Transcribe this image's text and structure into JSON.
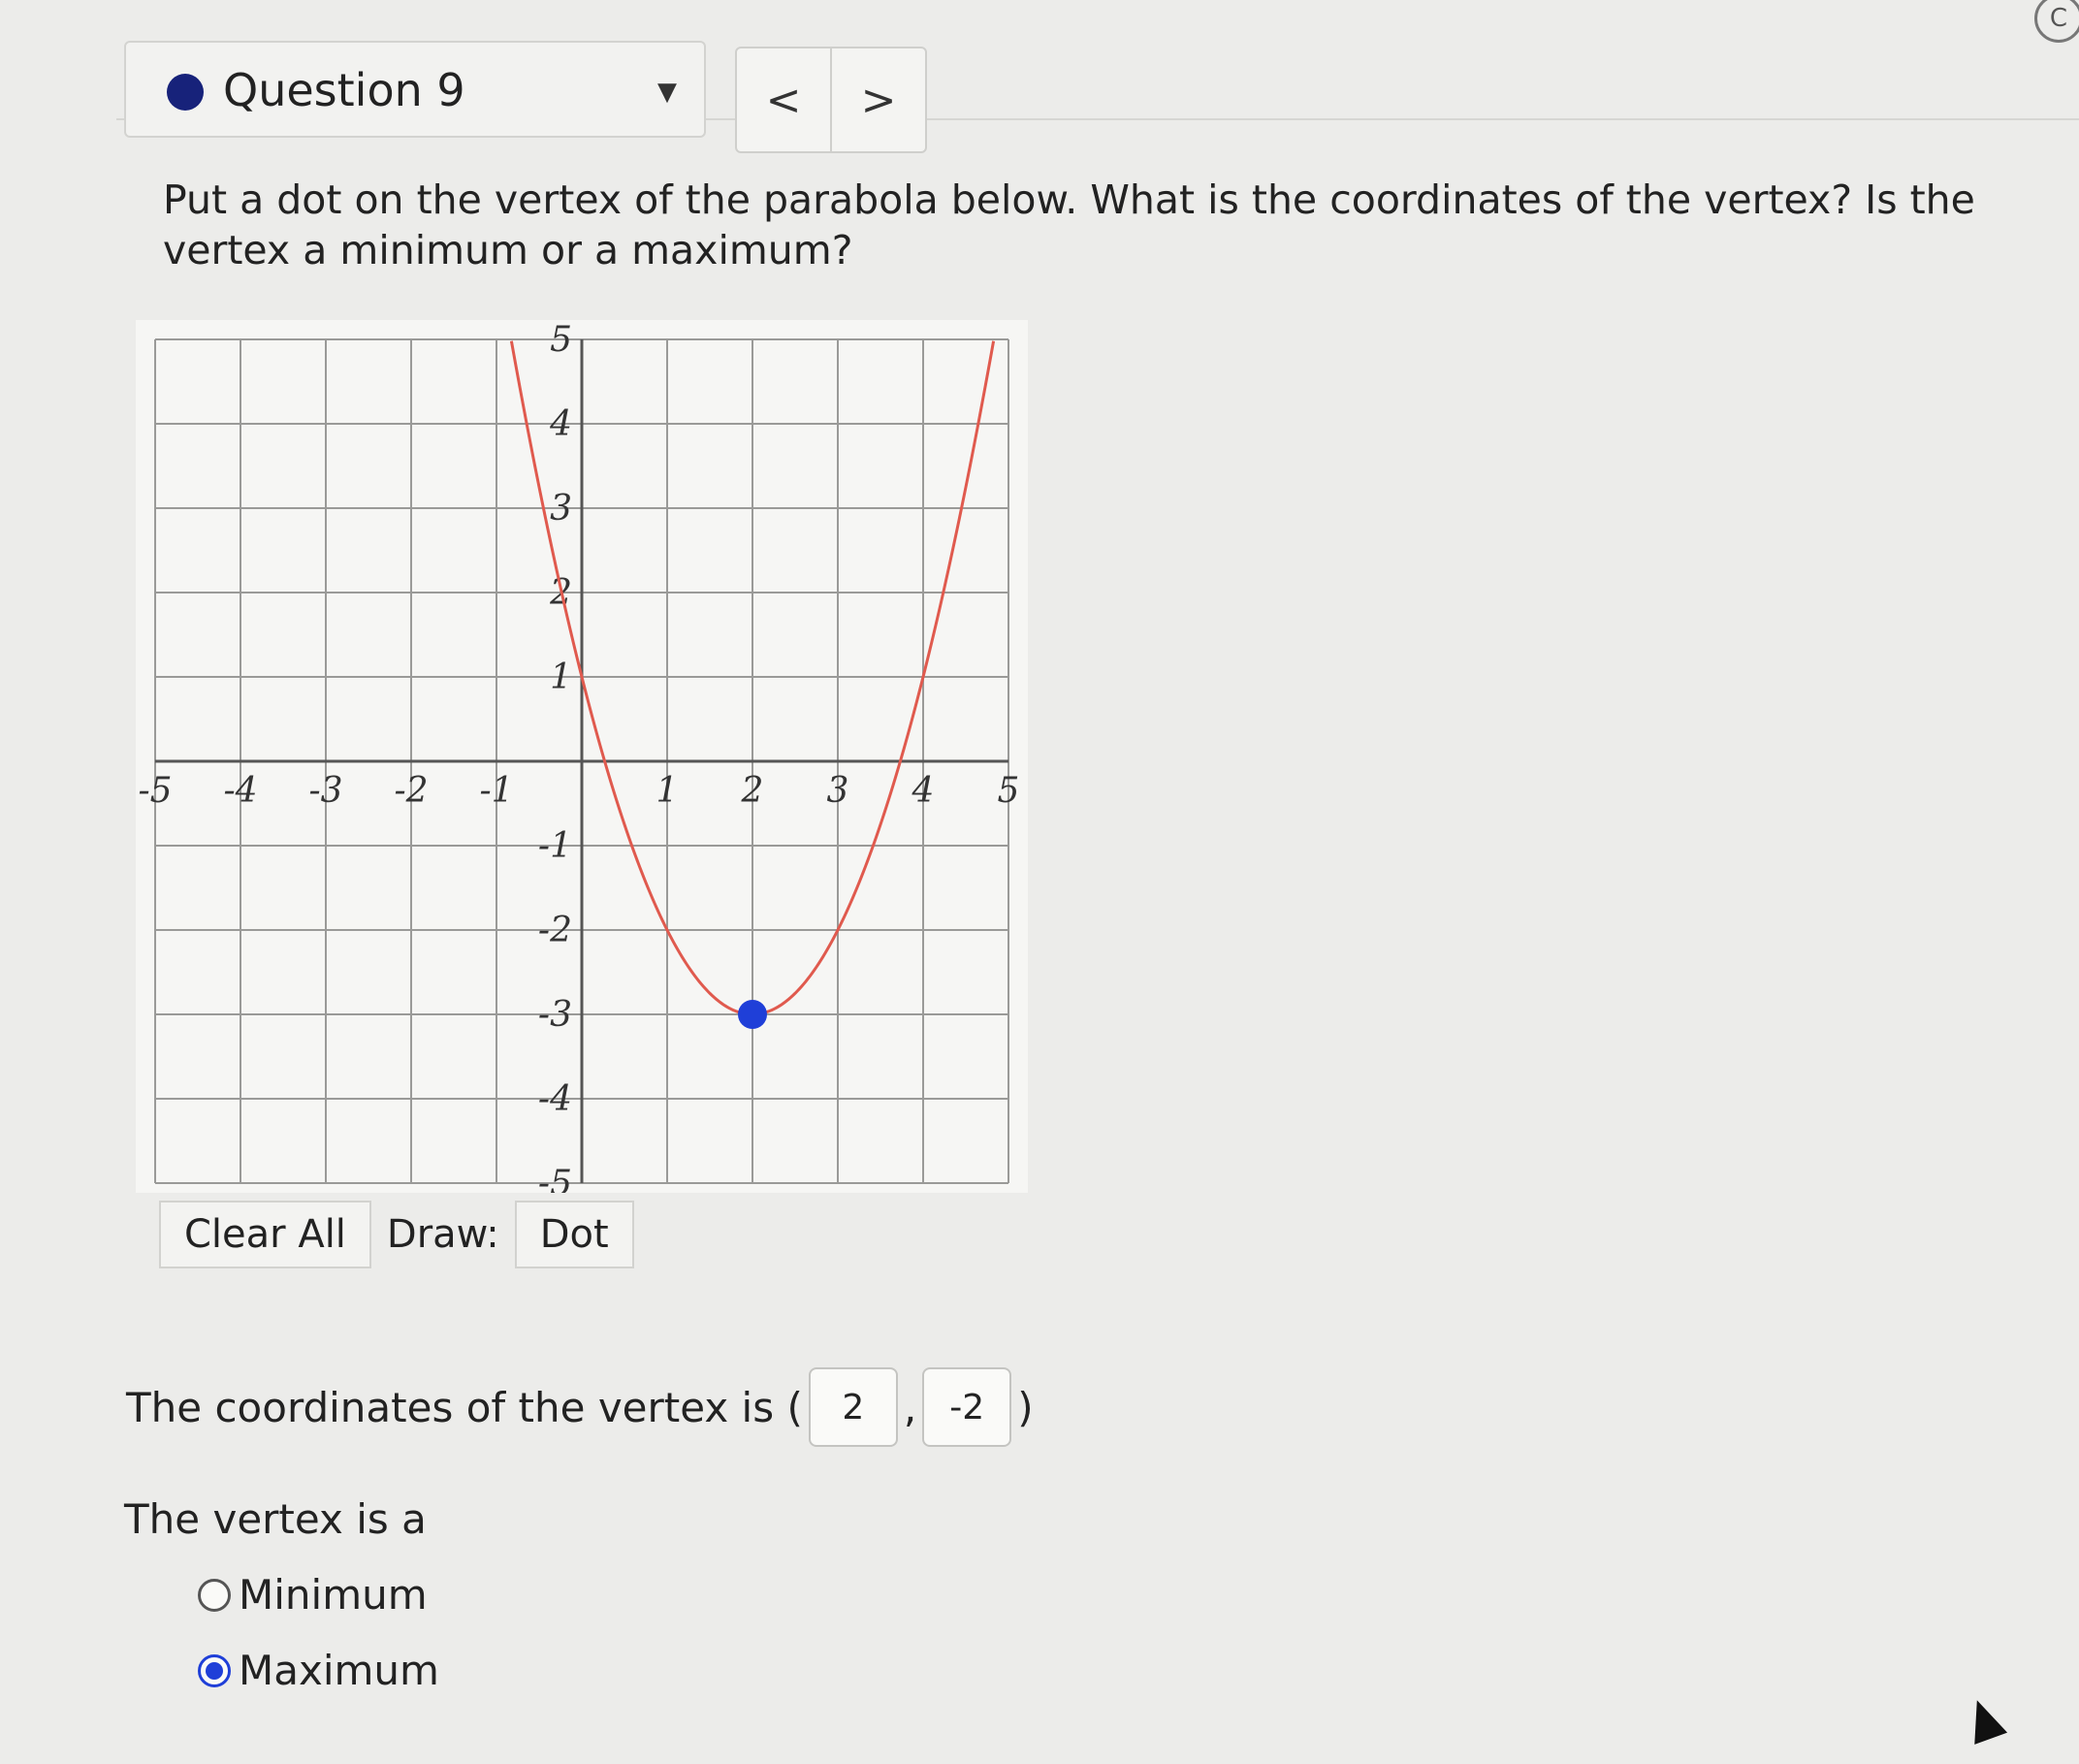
{
  "question_selector": {
    "label": "Question 9",
    "caret": "▼"
  },
  "nav": {
    "prev": "<",
    "next": ">"
  },
  "corner_icon": "C",
  "prompt": "Put a dot on the vertex of the parabola below. What is the coordinates of the vertex? Is the vertex a minimum or a maximum?",
  "chart_data": {
    "type": "line",
    "xlim": [
      -5,
      5
    ],
    "ylim": [
      -5,
      5
    ],
    "x_ticks": [
      "-5",
      "-4",
      "-3",
      "-2",
      "-1",
      "1",
      "2",
      "3",
      "4",
      "5"
    ],
    "y_ticks": [
      "5",
      "4",
      "3",
      "2",
      "1",
      "-1",
      "-2",
      "-3",
      "-4",
      "-5"
    ],
    "grid": true,
    "curve": {
      "type": "parabola",
      "vertex": [
        2,
        -3
      ],
      "a": 1,
      "color": "#e05a4e"
    },
    "points": [
      {
        "x": 2,
        "y": -3,
        "color": "#1f3fd8"
      }
    ]
  },
  "toolbar": {
    "clear_all": "Clear All",
    "draw_label": "Draw:",
    "dot": "Dot"
  },
  "coords": {
    "prefix": "The coordinates of the vertex is (",
    "x_value": "2",
    "separator": ",",
    "y_value": "-2",
    "suffix": ")"
  },
  "vertex_question": "The vertex is a",
  "options": [
    {
      "label": "Minimum",
      "checked": false
    },
    {
      "label": "Maximum",
      "checked": true
    }
  ]
}
